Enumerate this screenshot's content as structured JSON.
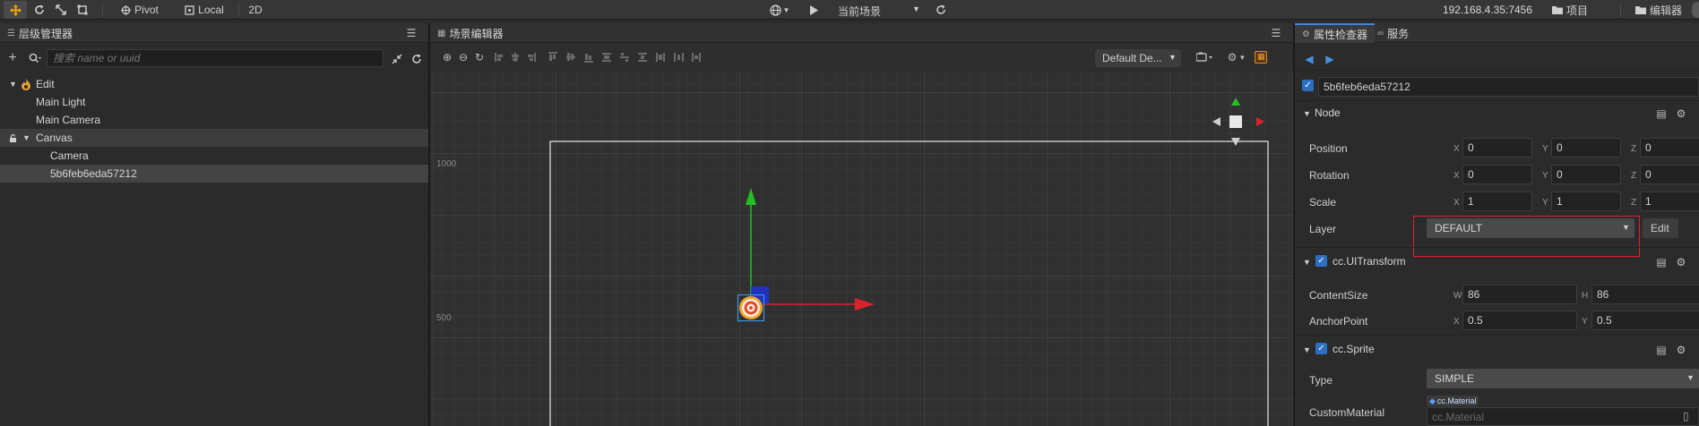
{
  "toolbar": {
    "pivot_label": "Pivot",
    "local_label": "Local",
    "mode_2d_label": "2D",
    "scene_select_value": "当前场景",
    "ip_address": "192.168.4.35:7456",
    "project_label": "项目",
    "editor_label": "编辑器"
  },
  "hierarchy": {
    "tab_label": "层级管理器",
    "search_placeholder": "搜索 name or uuid",
    "items": [
      {
        "label": "Edit"
      },
      {
        "label": "Main Light"
      },
      {
        "label": "Main Camera"
      },
      {
        "label": "Canvas"
      },
      {
        "label": "Camera"
      },
      {
        "label": "5b6feb6eda57212"
      }
    ]
  },
  "scene": {
    "tab_label": "场景编辑器",
    "camera_select": "Default De...",
    "ruler_1000": "1000",
    "ruler_500": "500"
  },
  "inspector": {
    "tab_label": "属性检查器",
    "tab2_label": "服务",
    "node_name": "5b6feb6eda57212",
    "node_section": "Node",
    "position": {
      "label": "Position",
      "x": "0",
      "y": "0",
      "z": "0"
    },
    "rotation": {
      "label": "Rotation",
      "x": "0",
      "y": "0",
      "z": "0"
    },
    "scale": {
      "label": "Scale",
      "x": "1",
      "y": "1",
      "z": "1"
    },
    "layer": {
      "label": "Layer",
      "value": "DEFAULT",
      "edit_label": "Edit"
    },
    "uitransform_section": "cc.UITransform",
    "content_size": {
      "label": "ContentSize",
      "w": "86",
      "h": "86"
    },
    "anchor_point": {
      "label": "AnchorPoint",
      "x": "0.5",
      "y": "0.5"
    },
    "sprite_section": "cc.Sprite",
    "type": {
      "label": "Type",
      "value": "SIMPLE"
    },
    "custom_material": {
      "label": "CustomMaterial",
      "tag": "cc.Material",
      "placeholder": "cc.Material"
    },
    "axis_x": "X",
    "axis_y": "Y",
    "axis_z": "Z",
    "axis_w": "W",
    "axis_h": "H"
  },
  "colors": {
    "accent": "#3f86d6",
    "highlight_box": "#d9232d",
    "gizmo_x": "#d9232d",
    "gizmo_y": "#22c022"
  }
}
